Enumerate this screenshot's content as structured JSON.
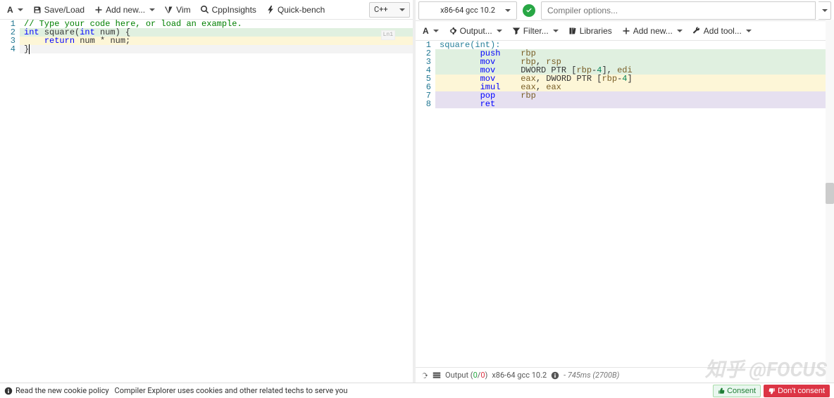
{
  "left": {
    "toolbar": {
      "font_label": "A",
      "save_label": "Save/Load",
      "add_label": "Add new...",
      "vim_label": "Vim",
      "cppinsights_label": "CppInsights",
      "quickbench_label": "Quick-bench",
      "language": "C++"
    },
    "code": {
      "lines": [
        {
          "n": 1,
          "cls": "",
          "html": "<span class='tok-com'>// Type your code here, or load an example.</span>"
        },
        {
          "n": 2,
          "cls": "hl-grn",
          "html": "<span class='tok-kw'>int</span> square(<span class='tok-kw'>int</span> num) {"
        },
        {
          "n": 3,
          "cls": "hl-yel",
          "html": "    <span class='tok-kw'>return</span> num * num;"
        },
        {
          "n": 4,
          "cls": "hl-pur cur-line",
          "html": "}<span style='border-left:1px solid #000;'></span>"
        }
      ]
    }
  },
  "right": {
    "top": {
      "compiler": "x86-64 gcc 10.2",
      "opts_placeholder": "Compiler options..."
    },
    "toolbar": {
      "font_label": "A",
      "output_label": "Output...",
      "filter_label": "Filter...",
      "libraries_label": "Libraries",
      "add_label": "Add new...",
      "addtool_label": "Add tool..."
    },
    "asm": {
      "lines": [
        {
          "n": 1,
          "cls": "",
          "html": "<span class='tok-lbl'>square(int):</span>"
        },
        {
          "n": 2,
          "cls": "hl-grn",
          "html": "        <span class='tok-kw'>push</span>    <span class='tok-reg'>rbp</span>"
        },
        {
          "n": 3,
          "cls": "hl-grn",
          "html": "        <span class='tok-kw'>mov</span>     <span class='tok-reg'>rbp</span>, <span class='tok-reg'>rsp</span>"
        },
        {
          "n": 4,
          "cls": "hl-grn",
          "html": "        <span class='tok-kw'>mov</span>     DWORD PTR [<span class='tok-reg'>rbp</span>-<span class='tok-num'>4</span>], <span class='tok-reg'>edi</span>"
        },
        {
          "n": 5,
          "cls": "hl-yel",
          "html": "        <span class='tok-kw'>mov</span>     <span class='tok-reg'>eax</span>, DWORD PTR [<span class='tok-reg'>rbp</span>-<span class='tok-num'>4</span>]"
        },
        {
          "n": 6,
          "cls": "hl-yel",
          "html": "        <span class='tok-kw'>imul</span>    <span class='tok-reg'>eax</span>, <span class='tok-reg'>eax</span>"
        },
        {
          "n": 7,
          "cls": "hl-pur",
          "html": "        <span class='tok-kw'>pop</span>     <span class='tok-reg'>rbp</span>"
        },
        {
          "n": 8,
          "cls": "hl-pur",
          "html": "        <span class='tok-kw'>ret</span>"
        }
      ]
    },
    "status": {
      "output_label": "Output (",
      "output_ok": "0",
      "output_sep": "/",
      "output_err": "0",
      "output_close": ")",
      "compiler": "x86-64 gcc 10.2",
      "timing": "- 745ms (2700B)"
    }
  },
  "cookie": {
    "read_label": "Read the new cookie policy",
    "msg": "Compiler Explorer uses cookies and other related techs to serve you",
    "consent": "Consent",
    "dont": "Don't consent"
  },
  "watermark": "知乎 @FOCUS"
}
